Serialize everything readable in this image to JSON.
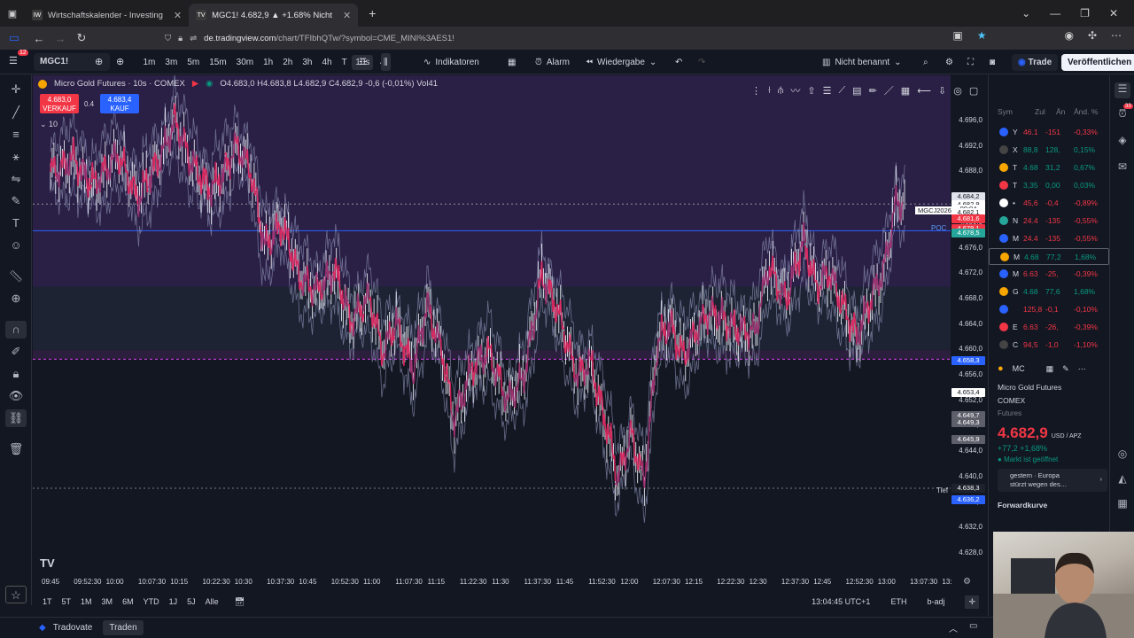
{
  "browser": {
    "tabs": [
      {
        "label": "Wirtschaftskalender - Investing",
        "favicon": "IW"
      },
      {
        "label": "MGC1! 4.682,9 ▲ +1.68% Nicht",
        "favicon": "TV"
      }
    ],
    "new_tab": "+",
    "url_host": "de.tradingview.com",
    "url_path": "/chart/TFIbhQTw/?symbol=CME_MINI%3AES1!"
  },
  "toolbar": {
    "symbol": "MGC1!",
    "intervals": [
      "1m",
      "3m",
      "5m",
      "15m",
      "30m",
      "1h",
      "2h",
      "3h",
      "4h",
      "T",
      "10s"
    ],
    "selected_interval": "10s",
    "indicators": "Indikatoren",
    "alarm": "Alarm",
    "replay": "Wiedergabe",
    "layout_name": "Nicht benannt",
    "trade": "Trade",
    "publish": "Veröffentlichen"
  },
  "legend": {
    "title": "Micro Gold Futures · 10s · COMEX",
    "ohlc": "O4.683,0 H4.683,8 L4.682,9 C4.682,9 -0,6 (-0,01%) Vol41",
    "sell_price": "4.683,0",
    "sell_label": "VERKAUF",
    "buy_price": "4.683,4",
    "buy_label": "KAUF",
    "spread": "0.4",
    "qty": "10"
  },
  "price_scale": {
    "ticks": [
      "4.696,0",
      "4.692,0",
      "4.688,0",
      "4.684,2",
      "4.680,0",
      "4.676,0",
      "4.672,0",
      "4.668,0",
      "4.664,0",
      "4.660,0",
      "4.656,0",
      "4.652,0",
      "4.648,0",
      "4.644,0",
      "4.640,0",
      "4.636,0",
      "4.632,0",
      "4.628,0"
    ],
    "tags": [
      {
        "text": "4.684,2",
        "bg": "#e0e3eb",
        "fg": "#131722",
        "y": 4684.2
      },
      {
        "text": "4.682,9",
        "bg": "#ffffff",
        "fg": "#131722",
        "y": 4682.9
      },
      {
        "text": "00:04",
        "bg": "#ffffff",
        "fg": "#131722",
        "y": 4682.2
      },
      {
        "text": "4.682,1",
        "bg": "#ffffff",
        "fg": "#131722",
        "y": 4681.6
      },
      {
        "text": "4.681,6",
        "bg": "#f23645",
        "fg": "#ffffff",
        "y": 4680.6
      },
      {
        "text": "4.679,1",
        "bg": "#f23645",
        "fg": "#ffffff",
        "y": 4679.1
      },
      {
        "text": "4.678,5",
        "bg": "#26a69a",
        "fg": "#ffffff",
        "y": 4678.5
      },
      {
        "text": "4.658,3",
        "bg": "#2962ff",
        "fg": "#ffffff",
        "y": 4658.3
      },
      {
        "text": "4.653,4",
        "bg": "#ffffff",
        "fg": "#131722",
        "y": 4653.4
      },
      {
        "text": "4.649,7",
        "bg": "#5d606b",
        "fg": "#ffffff",
        "y": 4649.7
      },
      {
        "text": "4.649,3",
        "bg": "#5d606b",
        "fg": "#ffffff",
        "y": 4648.6
      },
      {
        "text": "4.645,9",
        "bg": "#5d606b",
        "fg": "#ffffff",
        "y": 4645.9
      },
      {
        "text": "4.638,3",
        "bg": "#1e222d",
        "fg": "#ffffff",
        "y": 4638.3
      },
      {
        "text": "4.636,2",
        "bg": "#2962ff",
        "fg": "#ffffff",
        "y": 4636.5
      }
    ],
    "symbol_tag": "MGCJ2026",
    "poc": "POC",
    "tief": "Tief"
  },
  "time_scale": [
    "09:45",
    "09:52:30",
    "10:00",
    "10:07:30",
    "10:15",
    "10:22:30",
    "10:30",
    "10:37:30",
    "10:45",
    "10:52:30",
    "11:00",
    "11:07:30",
    "11:15",
    "11:22:30",
    "11:30",
    "11:37:30",
    "11:45",
    "11:52:30",
    "12:00",
    "12:07:30",
    "12:15",
    "12:22:30",
    "12:30",
    "12:37:30",
    "12:45",
    "12:52:30",
    "13:00",
    "13:07:30",
    "13:"
  ],
  "range": {
    "buttons": [
      "1T",
      "5T",
      "1M",
      "3M",
      "6M",
      "YTD",
      "1J",
      "5J",
      "Alle"
    ],
    "clock": "13:04:45 UTC+1",
    "session": "ETH",
    "adj": "b-adj"
  },
  "bottom": {
    "broker": "Tradovate",
    "trade": "Traden"
  },
  "watchlist": {
    "columns": [
      "Sym",
      "Zul",
      "Än",
      "Änd. %"
    ],
    "rows": [
      {
        "sym": "Y",
        "last": "46.1",
        "chg": "-151",
        "pct": "-0,33%",
        "dir": "neg",
        "icon": "#2962ff"
      },
      {
        "sym": "X",
        "last": "88,8",
        "chg": "128,",
        "pct": "0,15%",
        "dir": "pos",
        "icon": "#444"
      },
      {
        "sym": "T",
        "last": "4.68",
        "chg": "31,2",
        "pct": "0,67%",
        "dir": "pos",
        "icon": "#f7a600"
      },
      {
        "sym": "T",
        "last": "3,35",
        "chg": "0,00",
        "pct": "0,03%",
        "dir": "pos",
        "icon": "#f23645"
      },
      {
        "sym": "•",
        "last": "45,6",
        "chg": "-0,4",
        "pct": "-0,89%",
        "dir": "neg",
        "icon": "#ffffff"
      },
      {
        "sym": "N",
        "last": "24.4",
        "chg": "-135",
        "pct": "-0,55%",
        "dir": "neg",
        "icon": "#26a69a"
      },
      {
        "sym": "M",
        "last": "24.4",
        "chg": "-135",
        "pct": "-0,55%",
        "dir": "neg",
        "icon": "#2962ff"
      },
      {
        "sym": "M",
        "last": "4.68",
        "chg": "77,2",
        "pct": "1,68%",
        "dir": "pos",
        "icon": "#f7a600"
      },
      {
        "sym": "M",
        "last": "6.63",
        "chg": "-25,",
        "pct": "-0,39%",
        "dir": "neg",
        "icon": "#2962ff"
      },
      {
        "sym": "G",
        "last": "4.68",
        "chg": "77,6",
        "pct": "1,68%",
        "dir": "pos",
        "icon": "#f7a600"
      },
      {
        "sym": "",
        "last": "125,8",
        "chg": "-0,1",
        "pct": "-0,10%",
        "dir": "neg",
        "icon": "#2962ff"
      },
      {
        "sym": "E",
        "last": "6.63",
        "chg": "-26,",
        "pct": "-0,39%",
        "dir": "neg",
        "icon": "#f23645"
      },
      {
        "sym": "C",
        "last": "94,5",
        "chg": "-1,0",
        "pct": "-1,10%",
        "dir": "neg",
        "icon": "#444"
      }
    ]
  },
  "details": {
    "short": "MC",
    "name": "Micro Gold Futures",
    "exchange": "COMEX",
    "type": "Futures",
    "price": "4.682,9",
    "currency": "USD / APZ",
    "change": "+77,2 +1,68%",
    "market": "Markt ist geöffnet",
    "news1": "gestern · Europa",
    "news2": "stürzt wegen des…",
    "forward": "Forwardkurve"
  },
  "notification_badge": "33",
  "colors": {
    "bg": "#131722",
    "up": "#089981",
    "down": "#f23645",
    "accent": "#2962ff"
  }
}
